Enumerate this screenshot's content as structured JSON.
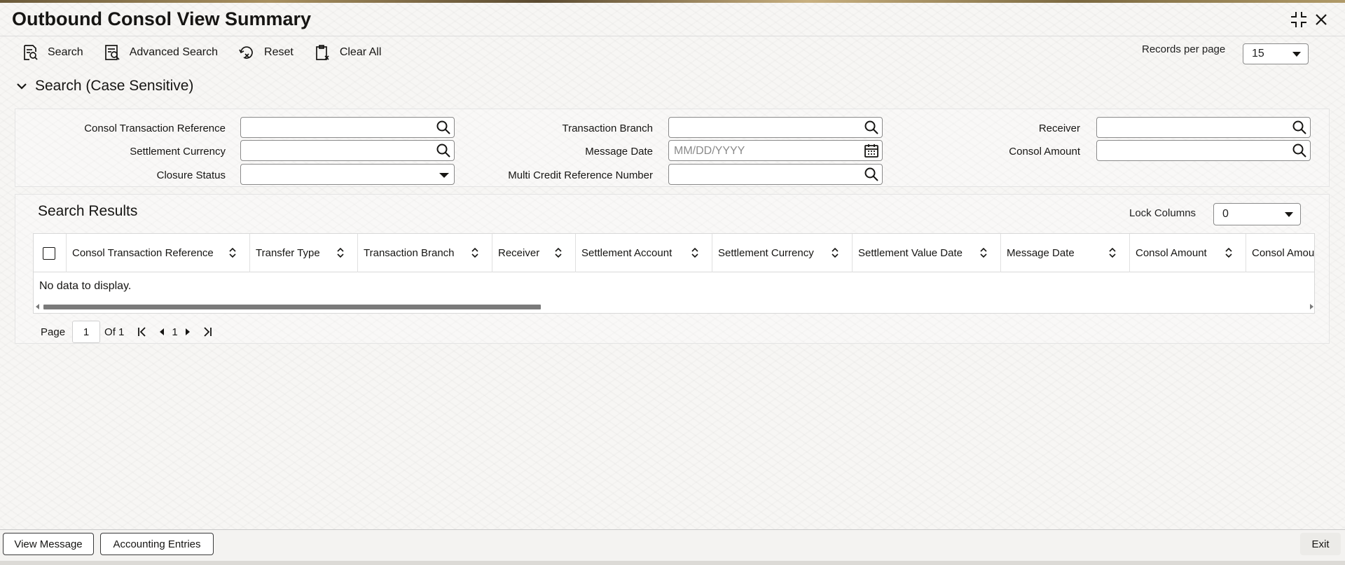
{
  "window": {
    "title": "Outbound Consol View Summary"
  },
  "toolbar": {
    "search": "Search",
    "advanced_search": "Advanced Search",
    "reset": "Reset",
    "clear_all": "Clear All",
    "records_per_page_label": "Records per page",
    "records_per_page_value": "15"
  },
  "search_section": {
    "title": "Search (Case Sensitive)",
    "fields": {
      "consol_ref": "Consol Transaction Reference",
      "transaction_branch": "Transaction Branch",
      "receiver": "Receiver",
      "settlement_currency": "Settlement Currency",
      "message_date": "Message Date",
      "message_date_placeholder": "MM/DD/YYYY",
      "consol_amount": "Consol Amount",
      "closure_status": "Closure Status",
      "multi_credit_ref": "Multi Credit Reference Number"
    }
  },
  "results": {
    "title": "Search Results",
    "lock_columns_label": "Lock Columns",
    "lock_columns_value": "0",
    "columns": [
      "Consol Transaction Reference",
      "Transfer Type",
      "Transaction Branch",
      "Receiver",
      "Settlement Account",
      "Settlement Currency",
      "Settlement Value Date",
      "Message Date",
      "Consol Amount",
      "Consol Amou"
    ],
    "empty_text": "No data to display.",
    "pager": {
      "page_label": "Page",
      "page_value": "1",
      "of_label": "Of 1",
      "current": "1"
    }
  },
  "footer": {
    "view_message": "View Message",
    "accounting_entries": "Accounting Entries",
    "exit": "Exit"
  }
}
